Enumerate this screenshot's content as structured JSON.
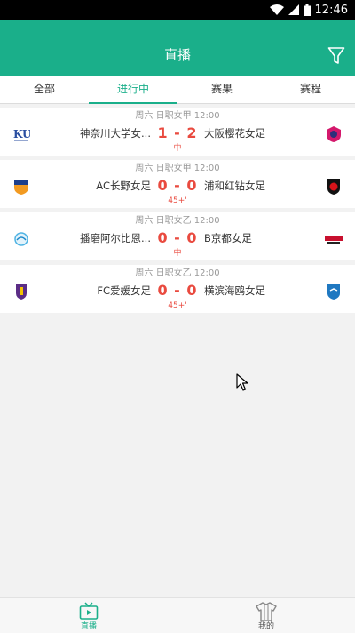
{
  "status_bar": {
    "time": "12:46"
  },
  "header": {
    "title": "直播"
  },
  "tabs": [
    {
      "label": "全部",
      "active": false
    },
    {
      "label": "进行中",
      "active": true
    },
    {
      "label": "赛果",
      "active": false
    },
    {
      "label": "赛程",
      "active": false
    }
  ],
  "matches": [
    {
      "league": "周六 日职女甲 12:00",
      "home": "神奈川大学女...",
      "away": "大阪樱花女足",
      "score": "1 - 2",
      "status": "中"
    },
    {
      "league": "周六 日职女甲 12:00",
      "home": "AC长野女足",
      "away": "浦和红钻女足",
      "score": "0 - 0",
      "status": "45+'"
    },
    {
      "league": "周六 日职女乙 12:00",
      "home": "播磨阿尔比恩...",
      "away": "B京都女足",
      "score": "0 - 0",
      "status": "中"
    },
    {
      "league": "周六 日职女乙 12:00",
      "home": "FC爱媛女足",
      "away": "横滨海鸥女足",
      "score": "0 - 0",
      "status": "45+'"
    }
  ],
  "bottom_nav": [
    {
      "label": "直播",
      "icon": "tv-icon",
      "active": true
    },
    {
      "label": "我的",
      "icon": "jersey-icon",
      "active": false
    }
  ],
  "colors": {
    "primary": "#1aaf8a",
    "score": "#e94a3f"
  }
}
